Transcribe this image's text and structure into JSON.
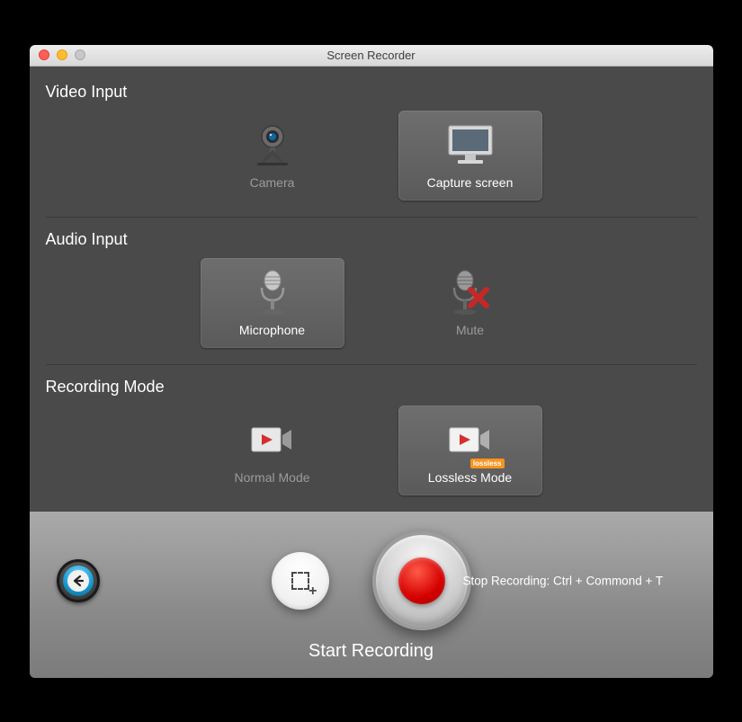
{
  "window": {
    "title": "Screen Recorder"
  },
  "sections": {
    "video": {
      "title": "Video Input",
      "camera_label": "Camera",
      "capture_label": "Capture screen"
    },
    "audio": {
      "title": "Audio Input",
      "mic_label": "Microphone",
      "mute_label": "Mute"
    },
    "mode": {
      "title": "Recording Mode",
      "normal_label": "Normal Mode",
      "lossless_label": "Lossless Mode",
      "lossless_tag": "lossless"
    }
  },
  "footer": {
    "start_label": "Start Recording",
    "stop_hint": "Stop Recording: Ctrl + Commond + T"
  }
}
